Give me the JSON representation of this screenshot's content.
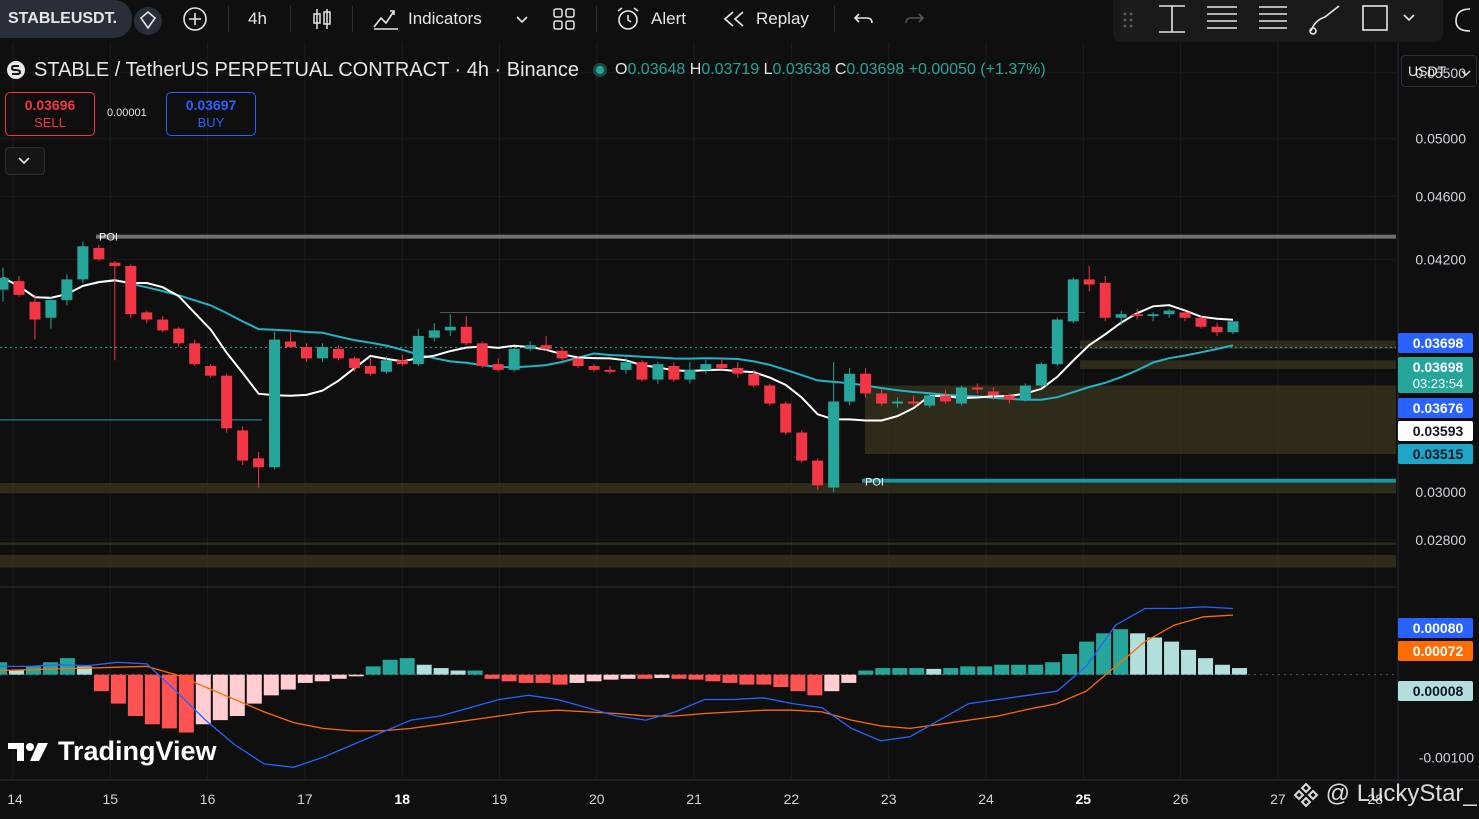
{
  "toolbar": {
    "symbol": "STABLEUSDT.",
    "interval": "4h",
    "indicators_label": "Indicators",
    "alert_label": "Alert",
    "replay_label": "Replay"
  },
  "legend": {
    "title": "STABLE / TetherUS PERPETUAL CONTRACT · 4h · Binance",
    "o_key": "O",
    "o": "0.03648",
    "h_key": "H",
    "h": "0.03719",
    "l_key": "L",
    "l": "0.03638",
    "c_key": "C",
    "c": "0.03698",
    "change": "+0.00050 (+1.37%)"
  },
  "trade": {
    "sell_price": "0.03696",
    "sell_label": "SELL",
    "spread": "0.00001",
    "buy_price": "0.03697",
    "buy_label": "BUY"
  },
  "currency": "USDT",
  "watermark": "TradingView",
  "credit": "@ LuckyStar_",
  "colors": {
    "up": "#26a69a",
    "down": "#f23645",
    "ma_fast": "#ffffff",
    "ma_slow": "#22b5c7",
    "macd": "#2962ff",
    "signal": "#ff6d00",
    "zone": "#3b3520",
    "background": "#0f0f0f"
  },
  "chart_data": [
    {
      "type": "candlestick",
      "title": "STABLE / TetherUS PERPETUAL CONTRACT · 4h · Binance",
      "x_ticks": [
        "14",
        "15",
        "16",
        "17",
        "18",
        "19",
        "20",
        "21",
        "22",
        "23",
        "24",
        "25",
        "26",
        "27",
        "28"
      ],
      "y_ticks": [
        "0.05500",
        "0.05000",
        "0.04600",
        "0.04200",
        "0.03000",
        "0.02800"
      ],
      "ylim": [
        0.0265,
        0.0575
      ],
      "scale": "log",
      "poi_labels": [
        "POI",
        "POI"
      ],
      "poi_levels": [
        0.0434,
        0.0305
      ],
      "zones": [
        {
          "from": 0.0369,
          "to": 0.03735
        },
        {
          "from": 0.03585,
          "to": 0.0363
        },
        {
          "from": 0.0317,
          "to": 0.035
        },
        {
          "from": 0.02995,
          "to": 0.0304
        },
        {
          "from": 0.0278,
          "to": 0.0279
        },
        {
          "from": 0.0269,
          "to": 0.0274
        }
      ],
      "price_labels": [
        {
          "value": "0.03698",
          "kind": "blue"
        },
        {
          "value": "0.03698",
          "kind": "current",
          "countdown": "03:23:54"
        },
        {
          "value": "0.03676",
          "kind": "blue"
        },
        {
          "value": "0.03593",
          "kind": "white"
        },
        {
          "value": "0.03515",
          "kind": "teal"
        }
      ],
      "candles_ohlc": [
        [
          0.0402,
          0.0415,
          0.0395,
          0.0409
        ],
        [
          0.0407,
          0.041,
          0.0398,
          0.0399
        ],
        [
          0.0395,
          0.0399,
          0.0374,
          0.0385
        ],
        [
          0.0386,
          0.0398,
          0.038,
          0.0396
        ],
        [
          0.0396,
          0.0411,
          0.0393,
          0.0408
        ],
        [
          0.0408,
          0.0431,
          0.0406,
          0.0428
        ],
        [
          0.0427,
          0.0429,
          0.0419,
          0.042
        ],
        [
          0.0418,
          0.0419,
          0.0363,
          0.0416
        ],
        [
          0.0416,
          0.0417,
          0.0386,
          0.0388
        ],
        [
          0.0389,
          0.039,
          0.0383,
          0.0385
        ],
        [
          0.0385,
          0.0387,
          0.0378,
          0.0379
        ],
        [
          0.038,
          0.0381,
          0.037,
          0.0372
        ],
        [
          0.0372,
          0.0374,
          0.036,
          0.0361
        ],
        [
          0.036,
          0.0361,
          0.0354,
          0.0355
        ],
        [
          0.0355,
          0.0356,
          0.0327,
          0.0329
        ],
        [
          0.0328,
          0.033,
          0.0312,
          0.0314
        ],
        [
          0.0315,
          0.0318,
          0.0302,
          0.0311
        ],
        [
          0.0311,
          0.0378,
          0.031,
          0.0374
        ],
        [
          0.0373,
          0.0378,
          0.037,
          0.037
        ],
        [
          0.037,
          0.0372,
          0.0362,
          0.0364
        ],
        [
          0.0364,
          0.0372,
          0.0362,
          0.037
        ],
        [
          0.0369,
          0.0371,
          0.0363,
          0.0364
        ],
        [
          0.0364,
          0.0365,
          0.0357,
          0.0359
        ],
        [
          0.036,
          0.0364,
          0.0355,
          0.0356
        ],
        [
          0.0357,
          0.0365,
          0.0356,
          0.0363
        ],
        [
          0.0363,
          0.0366,
          0.036,
          0.0361
        ],
        [
          0.0361,
          0.038,
          0.036,
          0.0376
        ],
        [
          0.0375,
          0.0383,
          0.0373,
          0.0379
        ],
        [
          0.0379,
          0.0388,
          0.0376,
          0.0381
        ],
        [
          0.0381,
          0.0387,
          0.0371,
          0.0372
        ],
        [
          0.0372,
          0.0373,
          0.0359,
          0.036
        ],
        [
          0.0361,
          0.0364,
          0.0357,
          0.0358
        ],
        [
          0.0358,
          0.037,
          0.0357,
          0.0369
        ],
        [
          0.0369,
          0.0373,
          0.0368,
          0.0371
        ],
        [
          0.0371,
          0.0376,
          0.0368,
          0.0369
        ],
        [
          0.0368,
          0.037,
          0.0363,
          0.0364
        ],
        [
          0.0364,
          0.0365,
          0.0359,
          0.036
        ],
        [
          0.036,
          0.0361,
          0.0357,
          0.0358
        ],
        [
          0.0358,
          0.036,
          0.0356,
          0.0357
        ],
        [
          0.0358,
          0.0364,
          0.0356,
          0.0362
        ],
        [
          0.0362,
          0.0363,
          0.0352,
          0.0353
        ],
        [
          0.0353,
          0.0362,
          0.0351,
          0.0361
        ],
        [
          0.036,
          0.0362,
          0.0352,
          0.0353
        ],
        [
          0.0353,
          0.0362,
          0.0351,
          0.0358
        ],
        [
          0.0358,
          0.0363,
          0.0356,
          0.0361
        ],
        [
          0.0361,
          0.0364,
          0.0358,
          0.0359
        ],
        [
          0.0359,
          0.0362,
          0.0354,
          0.0356
        ],
        [
          0.0356,
          0.0358,
          0.0349,
          0.035
        ],
        [
          0.035,
          0.0351,
          0.034,
          0.0341
        ],
        [
          0.0341,
          0.0342,
          0.0326,
          0.0327
        ],
        [
          0.0327,
          0.0328,
          0.0313,
          0.0314
        ],
        [
          0.0314,
          0.0315,
          0.0301,
          0.0303
        ],
        [
          0.0302,
          0.0362,
          0.03,
          0.0342
        ],
        [
          0.0342,
          0.0359,
          0.034,
          0.0356
        ],
        [
          0.0356,
          0.0359,
          0.0344,
          0.0346
        ],
        [
          0.0346,
          0.0348,
          0.034,
          0.0341
        ],
        [
          0.0341,
          0.0344,
          0.0339,
          0.0342
        ],
        [
          0.0342,
          0.0345,
          0.034,
          0.0341
        ],
        [
          0.034,
          0.0346,
          0.0339,
          0.0345
        ],
        [
          0.0345,
          0.0348,
          0.0341,
          0.0342
        ],
        [
          0.0341,
          0.035,
          0.034,
          0.0349
        ],
        [
          0.0349,
          0.0351,
          0.0346,
          0.0348
        ],
        [
          0.0347,
          0.0349,
          0.0343,
          0.0345
        ],
        [
          0.0345,
          0.0346,
          0.0341,
          0.0343
        ],
        [
          0.0343,
          0.0351,
          0.0342,
          0.035
        ],
        [
          0.035,
          0.0362,
          0.0349,
          0.0361
        ],
        [
          0.0361,
          0.0386,
          0.036,
          0.0385
        ],
        [
          0.0384,
          0.0409,
          0.0383,
          0.0408
        ],
        [
          0.0408,
          0.0416,
          0.0401,
          0.0405
        ],
        [
          0.0406,
          0.041,
          0.0384,
          0.0386
        ],
        [
          0.0386,
          0.039,
          0.0382,
          0.0388
        ],
        [
          0.0388,
          0.0391,
          0.0385,
          0.0387
        ],
        [
          0.0387,
          0.0389,
          0.0384,
          0.0388
        ],
        [
          0.0388,
          0.0391,
          0.0386,
          0.039
        ],
        [
          0.0389,
          0.039,
          0.0384,
          0.0386
        ],
        [
          0.0386,
          0.0387,
          0.038,
          0.0381
        ],
        [
          0.0381,
          0.0383,
          0.0376,
          0.0378
        ],
        [
          0.0378,
          0.0384,
          0.0377,
          0.0384
        ]
      ],
      "ma_fast_note": "white moving average",
      "ma_slow_note": "cyan moving average"
    },
    {
      "type": "line",
      "title": "MACD",
      "y_ticks": [
        "-0.00100"
      ],
      "ylim": [
        -0.00125,
        0.001
      ],
      "value_labels": [
        {
          "value": "0.00080",
          "kind": "macd"
        },
        {
          "value": "0.00072",
          "kind": "signal"
        },
        {
          "value": "0.00008",
          "kind": "histogram"
        }
      ],
      "series": [
        {
          "role": "macd",
          "values": [
            0.0001,
            0.0001,
            0.00012,
            0.00011,
            0.00015,
            0.00013,
            -0.0002,
            -0.00055,
            -0.00085,
            -0.00108,
            -0.00112,
            -0.001,
            -0.00085,
            -0.0007,
            -0.00055,
            -0.0005,
            -0.0004,
            -0.0003,
            -0.00025,
            -0.0003,
            -0.0004,
            -0.0005,
            -0.00055,
            -0.00045,
            -0.0003,
            -0.0003,
            -0.00028,
            -0.00035,
            -0.0004,
            -0.00065,
            -0.0008,
            -0.00075,
            -0.00055,
            -0.00035,
            -0.0003,
            -0.00025,
            -0.0002,
            0.0001,
            0.0006,
            0.0008,
            0.0008,
            0.00082,
            0.0008
          ]
        },
        {
          "role": "signal",
          "values": [
            5e-05,
            6e-05,
            7e-05,
            8e-05,
            9e-05,
            0.0001,
            0.0,
            -0.00015,
            -0.0003,
            -0.00045,
            -0.00058,
            -0.00065,
            -0.00068,
            -0.00068,
            -0.00065,
            -0.0006,
            -0.00055,
            -0.0005,
            -0.00045,
            -0.00043,
            -0.00045,
            -0.00047,
            -0.0005,
            -0.0005,
            -0.00047,
            -0.00045,
            -0.00043,
            -0.00043,
            -0.00045,
            -0.00055,
            -0.00062,
            -0.00065,
            -0.0006,
            -0.00055,
            -0.0005,
            -0.00042,
            -0.00035,
            -0.0002,
            0.0001,
            0.0004,
            0.0006,
            0.0007,
            0.00072
          ]
        }
      ],
      "histogram": [
        0.00015,
        5e-05,
        0.0001,
        0.00015,
        0.0002,
        0.0001,
        -0.0002,
        -0.00035,
        -0.0005,
        -0.0006,
        -0.00065,
        -0.0007,
        -0.0006,
        -0.00055,
        -0.0005,
        -0.00035,
        -0.00025,
        -0.00018,
        -0.0001,
        -8e-05,
        -5e-05,
        -2e-05,
        0.0001,
        0.00018,
        0.0002,
        0.00012,
        8e-05,
        5e-05,
        5e-05,
        -5e-05,
        -8e-05,
        -0.0001,
        -0.0001,
        -0.00012,
        -0.0001,
        -8e-05,
        -6e-05,
        -5e-05,
        -5e-05,
        -4e-05,
        -5e-05,
        -6e-05,
        -8e-05,
        -0.0001,
        -0.00012,
        -0.00012,
        -0.00015,
        -0.0002,
        -0.00025,
        -0.0002,
        -0.0001,
        5e-05,
        8e-05,
        8e-05,
        8e-05,
        7e-05,
        8e-05,
        0.0001,
        0.0001,
        0.00012,
        0.00012,
        0.00012,
        0.00015,
        0.00025,
        0.0004,
        0.0005,
        0.00055,
        0.0005,
        0.00045,
        0.0004,
        0.0003,
        0.0002,
        0.00012,
        8e-05
      ]
    }
  ]
}
